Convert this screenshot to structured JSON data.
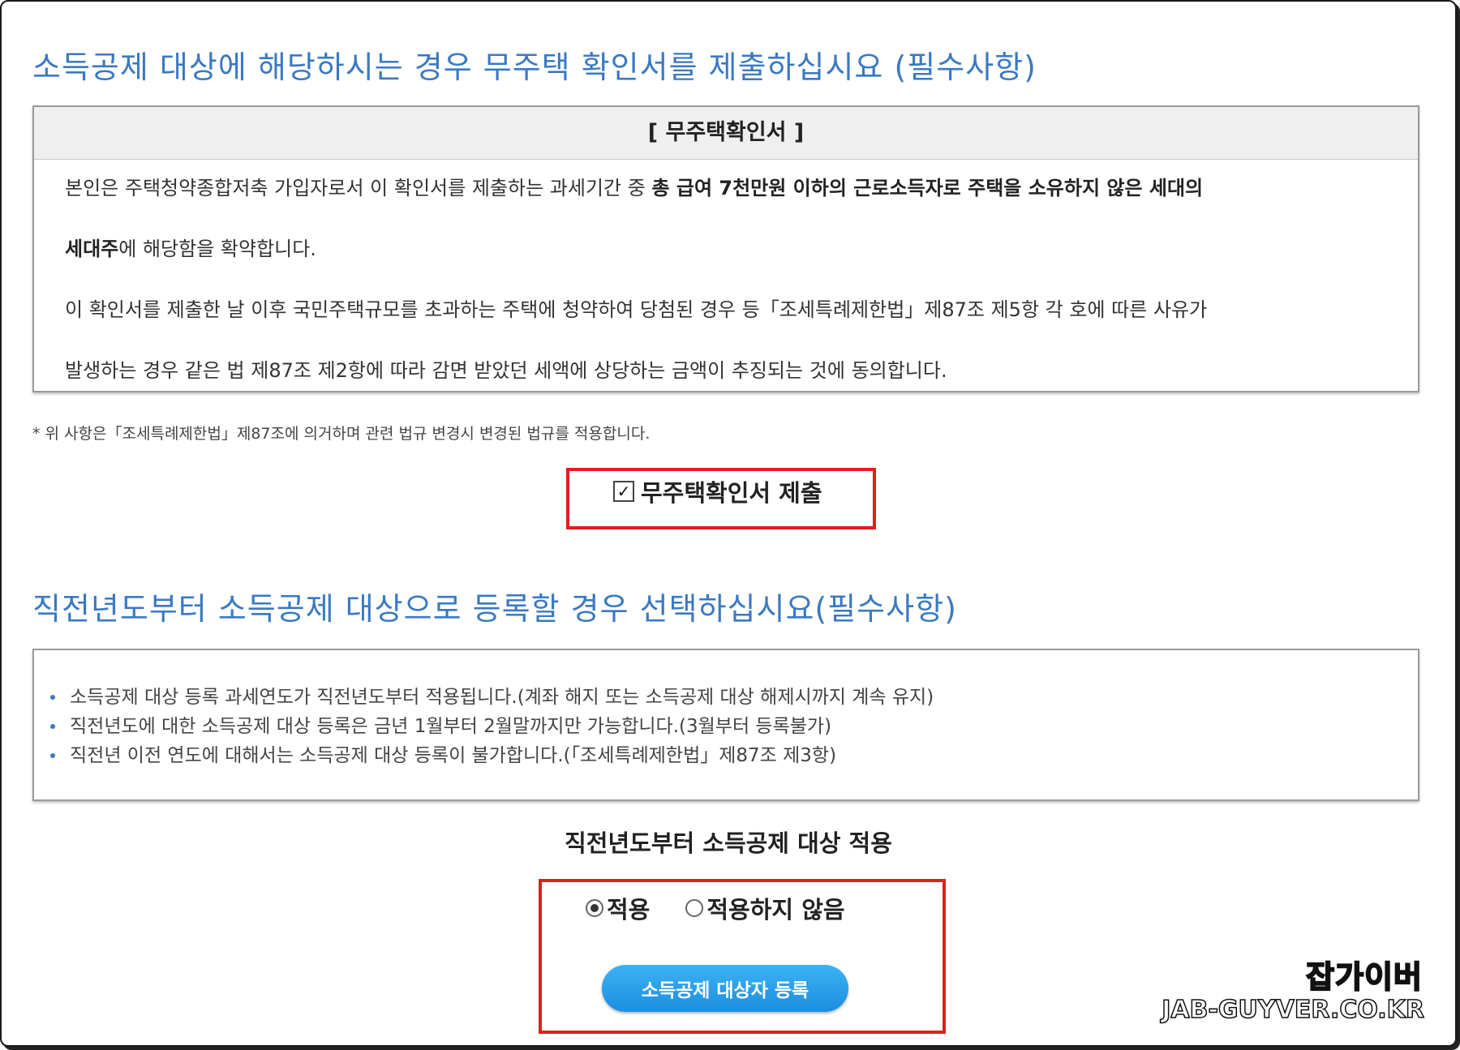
{
  "sections": {
    "confirm_title": "소득공제 대상에 해당하시는 경우 무주택 확인서를 제출하십시요 (필수사항)",
    "start_year_title": "직전년도부터 소득공제 대상으로 등록할 경우 선택하십시요(필수사항)"
  },
  "confirm_box": {
    "header": "[ 무주택확인서 ]",
    "line1_normal": "본인은 주택청약종합저축 가입자로서 이 확인서를 제출하는 과세기간 중 ",
    "line1_bold": "총 급여 7천만원 이하의 근로소득자로 주택을 소유하지 않은 세대의",
    "line2_bold": "세대주",
    "line2_normal": "에 해당함을 확약합니다.",
    "line3": "이 확인서를 제출한 날 이후 국민주택규모를 초과하는 주택에 청약하여 당첨된 경우 등「조세특례제한법」제87조 제5항 각 호에 따른 사유가",
    "line4": "발생하는 경우 같은 법 제87조 제2항에 따라 감면 받았던 세액에 상당하는 금액이 추징되는 것에 동의합니다."
  },
  "footnote": "* 위 사항은「조세특례제한법」제87조에 의거하며 관련 법규 변경시 변경된 법규를 적용합니다.",
  "submit_checkbox": {
    "label": "무주택확인서 제출",
    "checked": true,
    "check_glyph": "✓"
  },
  "info_box": {
    "items": [
      "소득공제 대상 등록 과세연도가 직전년도부터 적용됩니다.(계좌 해지 또는 소득공제 대상 해제시까지 계속 유지)",
      "직전년도에 대한 소득공제 대상 등록은 금년 1월부터 2월말까지만 가능합니다.(3월부터 등록불가)",
      "직전년 이전 연도에 대해서는 소득공제 대상 등록이 불가합니다.(「조세특례제한법」제87조 제3항)"
    ]
  },
  "apply": {
    "title": "직전년도부터 소득공제 대상 적용",
    "options": [
      {
        "label": "적용",
        "selected": true
      },
      {
        "label": "적용하지 않음",
        "selected": false
      }
    ],
    "register_button": "소득공제 대상자 등록"
  },
  "watermark": {
    "name": "잡가이버",
    "url": "JAB-GUYVER.CO.KR"
  },
  "colors": {
    "title_blue": "#3a79c2",
    "highlight_red": "#e51d1d",
    "button_blue": "#1b8fe0"
  }
}
